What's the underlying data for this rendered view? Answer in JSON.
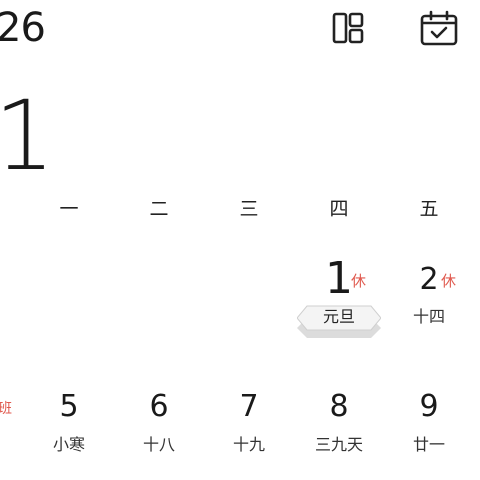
{
  "header": {
    "year_text": "26",
    "month_text": "1",
    "icons": [
      "layout-icon",
      "calendar-check-icon"
    ]
  },
  "weekdays": [
    "一",
    "二",
    "三",
    "四",
    "五"
  ],
  "week1": {
    "thu": {
      "day": "1",
      "badge": "休",
      "lunar": "元旦"
    },
    "fri": {
      "day": "2",
      "badge": "休",
      "lunar": "十四"
    }
  },
  "week2": {
    "partial_badge": "班",
    "mon": {
      "day": "5",
      "lunar": "小寒"
    },
    "tue": {
      "day": "6",
      "lunar": "十八"
    },
    "wed": {
      "day": "7",
      "lunar": "十九"
    },
    "thu": {
      "day": "8",
      "lunar": "三九天"
    },
    "fri": {
      "day": "9",
      "lunar": "廿一"
    }
  },
  "colors": {
    "text": "#1a1a1a",
    "rest_badge": "#e05a4f",
    "pill_fill": "#f2f2f2",
    "pill_shadow": "#d9d9d9"
  }
}
